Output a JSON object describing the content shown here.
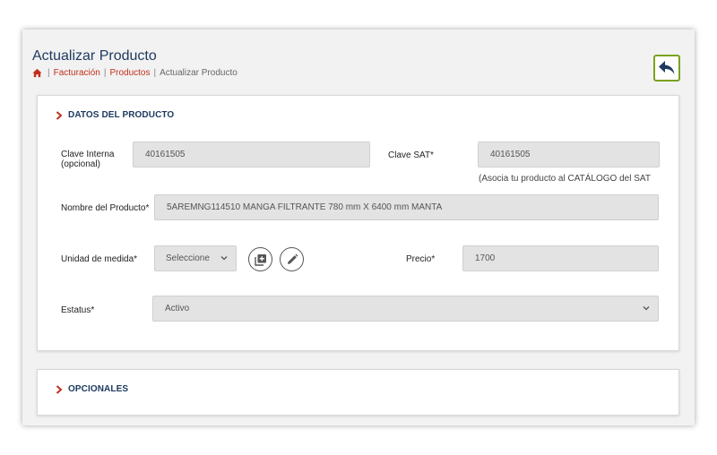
{
  "header": {
    "title": "Actualizar Producto",
    "breadcrumb": {
      "items": [
        "Facturación",
        "Productos",
        "Actualizar Producto"
      ]
    }
  },
  "sections": {
    "datos": {
      "title": "DATOS DEL PRODUCTO",
      "clave_interna": {
        "label_line1": "Clave Interna",
        "label_line2": "(opcional)",
        "value": "40161505"
      },
      "clave_sat": {
        "label": "Clave SAT*",
        "value": "40161505",
        "hint": "(Asocia tu producto al CATÁLOGO del SAT"
      },
      "nombre": {
        "label": "Nombre del Producto*",
        "value": "5AREMNG114510 MANGA FILTRANTE 780 mm X 6400 mm MANTA"
      },
      "unidad": {
        "label": "Unidad de medida*",
        "selected": "Seleccione"
      },
      "precio": {
        "label": "Precio*",
        "value": "1700"
      },
      "estatus": {
        "label": "Estatus*",
        "selected": "Activo"
      }
    },
    "opcionales": {
      "title": "OPCIONALES"
    }
  },
  "colors": {
    "title": "#1f3a60",
    "breadcrumb_link": "#c0301c",
    "back_border": "#7aa21f",
    "field_bg": "#e3e3e3"
  },
  "icons": {
    "home": "home-icon",
    "back": "back-arrow-icon",
    "section": "chevron-right-icon",
    "add": "add-box-icon",
    "edit": "pencil-icon",
    "dropdown": "chevron-down-icon"
  }
}
